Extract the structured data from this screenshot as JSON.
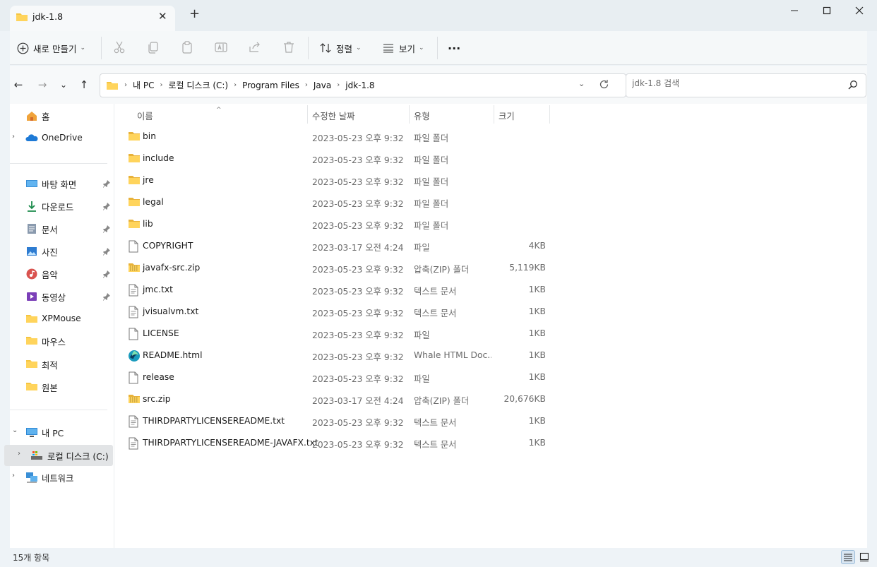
{
  "colors": {
    "folder": "#f5c542",
    "folder_dark": "#e0a82e",
    "accent": "#0f6cbd",
    "onedrive": "#1e7ad6"
  },
  "window": {
    "tab_title": "jdk-1.8",
    "tab_close": "✕",
    "new_tab": "+",
    "min": "—",
    "max": "☐",
    "close": "✕"
  },
  "toolbar": {
    "new_label": "새로 만들기",
    "sort_label": "정렬",
    "view_label": "보기",
    "more_label": "···",
    "chev": "⌄"
  },
  "nav": {
    "back": "←",
    "forward": "→",
    "recent": "⌄",
    "up": "↑"
  },
  "address": {
    "segments": [
      "내 PC",
      "로컬 디스크 (C:)",
      "Program Files",
      "Java",
      "jdk-1.8"
    ],
    "sep": "›"
  },
  "search": {
    "placeholder": "jdk-1.8 검색"
  },
  "sidebar": {
    "home": "홈",
    "onedrive": "OneDrive",
    "quick": [
      {
        "label": "바탕 화면",
        "icon": "desktop-icon",
        "pinned": true
      },
      {
        "label": "다운로드",
        "icon": "download-icon",
        "pinned": true
      },
      {
        "label": "문서",
        "icon": "documents-icon",
        "pinned": true
      },
      {
        "label": "사진",
        "icon": "pictures-icon",
        "pinned": true
      },
      {
        "label": "음악",
        "icon": "music-icon",
        "pinned": true
      },
      {
        "label": "동영상",
        "icon": "videos-icon",
        "pinned": true
      },
      {
        "label": "XPMouse",
        "icon": "folder-icon",
        "pinned": false
      },
      {
        "label": "마우스",
        "icon": "folder-icon",
        "pinned": false
      },
      {
        "label": "최적",
        "icon": "folder-icon",
        "pinned": false
      },
      {
        "label": "원본",
        "icon": "folder-icon",
        "pinned": false
      }
    ],
    "this_pc": "내 PC",
    "local_disk": "로컬 디스크 (C:)",
    "network": "네트워크",
    "expand": "›",
    "expanded": "⌄"
  },
  "columns": {
    "name": "이름",
    "date": "수정한 날짜",
    "type": "유형",
    "size": "크기",
    "sort_arrow": "^"
  },
  "files": [
    {
      "name": "bin",
      "date": "2023-05-23 오후 9:32",
      "type": "파일 폴더",
      "size": "",
      "icon": "folder-icon"
    },
    {
      "name": "include",
      "date": "2023-05-23 오후 9:32",
      "type": "파일 폴더",
      "size": "",
      "icon": "folder-icon"
    },
    {
      "name": "jre",
      "date": "2023-05-23 오후 9:32",
      "type": "파일 폴더",
      "size": "",
      "icon": "folder-icon"
    },
    {
      "name": "legal",
      "date": "2023-05-23 오후 9:32",
      "type": "파일 폴더",
      "size": "",
      "icon": "folder-icon"
    },
    {
      "name": "lib",
      "date": "2023-05-23 오후 9:32",
      "type": "파일 폴더",
      "size": "",
      "icon": "folder-icon"
    },
    {
      "name": "COPYRIGHT",
      "date": "2023-03-17 오전 4:24",
      "type": "파일",
      "size": "4KB",
      "icon": "file-icon"
    },
    {
      "name": "javafx-src.zip",
      "date": "2023-05-23 오후 9:32",
      "type": "압축(ZIP) 폴더",
      "size": "5,119KB",
      "icon": "zip-icon"
    },
    {
      "name": "jmc.txt",
      "date": "2023-05-23 오후 9:32",
      "type": "텍스트 문서",
      "size": "1KB",
      "icon": "text-file-icon"
    },
    {
      "name": "jvisualvm.txt",
      "date": "2023-05-23 오후 9:32",
      "type": "텍스트 문서",
      "size": "1KB",
      "icon": "text-file-icon"
    },
    {
      "name": "LICENSE",
      "date": "2023-05-23 오후 9:32",
      "type": "파일",
      "size": "1KB",
      "icon": "file-icon"
    },
    {
      "name": "README.html",
      "date": "2023-05-23 오후 9:32",
      "type": "Whale HTML Doc...",
      "size": "1KB",
      "icon": "whale-html-icon"
    },
    {
      "name": "release",
      "date": "2023-05-23 오후 9:32",
      "type": "파일",
      "size": "1KB",
      "icon": "file-icon"
    },
    {
      "name": "src.zip",
      "date": "2023-03-17 오전 4:24",
      "type": "압축(ZIP) 폴더",
      "size": "20,676KB",
      "icon": "zip-icon"
    },
    {
      "name": "THIRDPARTYLICENSEREADME.txt",
      "date": "2023-05-23 오후 9:32",
      "type": "텍스트 문서",
      "size": "1KB",
      "icon": "text-file-icon"
    },
    {
      "name": "THIRDPARTYLICENSEREADME-JAVAFX.txt",
      "date": "2023-05-23 오후 9:32",
      "type": "텍스트 문서",
      "size": "1KB",
      "icon": "text-file-icon"
    }
  ],
  "status": {
    "count": "15개 항목"
  }
}
